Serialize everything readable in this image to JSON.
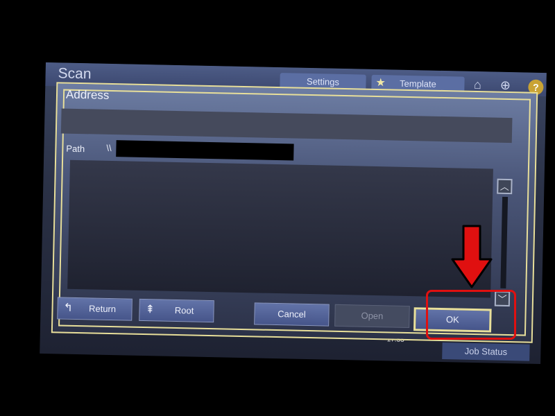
{
  "header": {
    "app_title": "Scan",
    "tabs": [
      {
        "label": "Settings"
      },
      {
        "label": "Template"
      }
    ],
    "icons": [
      "home-icon",
      "globe-icon",
      "help-icon"
    ],
    "help_glyph": "?"
  },
  "dialog": {
    "title": "Address",
    "path_label": "Path",
    "path_value": "\\\\",
    "buttons": {
      "return_label": "Return",
      "root_label": "Root",
      "cancel_label": "Cancel",
      "open_label": "Open",
      "ok_label": "OK"
    }
  },
  "status": {
    "time": "17:55",
    "job_status_label": "Job Status"
  },
  "colors": {
    "annotation": "#e01010",
    "dialog_border": "#e8df9a",
    "button": "#5566a0"
  }
}
